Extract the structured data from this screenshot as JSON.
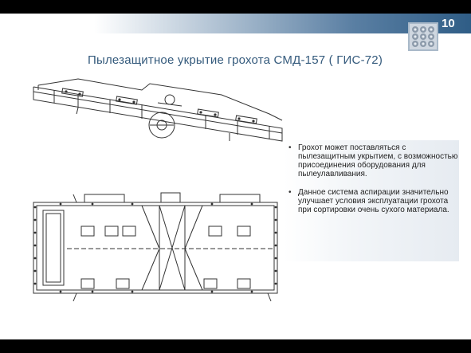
{
  "slide": {
    "page_number": "10",
    "title": "Пылезащитное укрытие грохота  СМД-157 ( ГИС-72)",
    "bullets": [
      {
        "text": "Грохот может поставляться с пылезащитным укрытием, с возможностью присоединения оборудования для пылеулавливания."
      },
      {
        "text": "Данное система аспирации значительно улучшает условия эксплуатации грохота  при  сортировки очень сухого материала."
      }
    ],
    "bullet_glyph": "•"
  },
  "colors": {
    "title": "#345a7c",
    "header_gradient_end": "#2f5d86"
  }
}
